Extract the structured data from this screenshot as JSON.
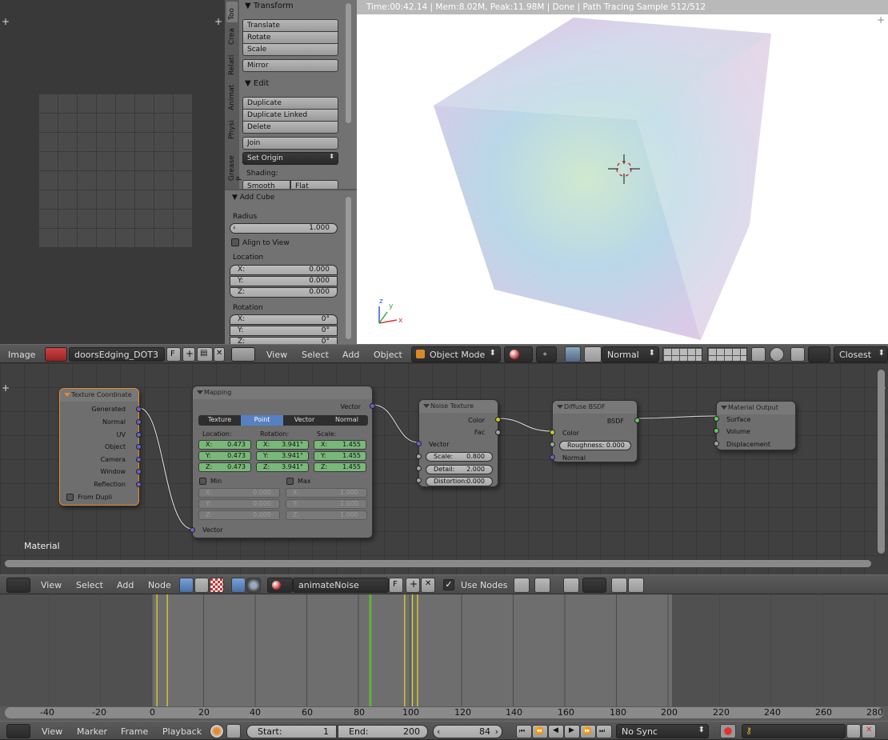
{
  "image_editor": {
    "title": "Image",
    "image_name": "doorsEdging_DOT3",
    "fake_user": "F"
  },
  "tool_tabs": [
    "Too",
    "Crea",
    "Relati",
    "Animat",
    "Physi",
    "Grease P"
  ],
  "transform": {
    "title": "Transform",
    "buttons": [
      "Translate",
      "Rotate",
      "Scale"
    ],
    "mirror": "Mirror"
  },
  "edit": {
    "title": "Edit",
    "buttons": [
      "Duplicate",
      "Duplicate Linked",
      "Delete"
    ],
    "join": "Join",
    "set_origin": "Set Origin",
    "shading_label": "Shading:",
    "shading": [
      "Smooth",
      "Flat"
    ]
  },
  "add_cube": {
    "title": "Add Cube",
    "radius_label": "Radius",
    "radius_value": "1.000",
    "align_label": "Align to View",
    "location_label": "Location",
    "location": [
      {
        "k": "X:",
        "v": "0.000"
      },
      {
        "k": "Y:",
        "v": "0.000"
      },
      {
        "k": "Z:",
        "v": "0.000"
      }
    ],
    "rotation_label": "Rotation",
    "rotation": [
      {
        "k": "X:",
        "v": "0°"
      },
      {
        "k": "Y:",
        "v": "0°"
      },
      {
        "k": "Z:",
        "v": "0°"
      }
    ]
  },
  "viewport": {
    "status": "Time:00:42.14 | Mem:8.02M, Peak:11.98M | Done | Path Tracing Sample 512/512",
    "axes": [
      "x",
      "y",
      "z"
    ],
    "menus": [
      "View",
      "Select",
      "Add",
      "Object"
    ],
    "mode": "Object Mode",
    "orientation": "Normal",
    "snap": "Closest"
  },
  "node_editor": {
    "label": "Material",
    "menus": [
      "View",
      "Select",
      "Add",
      "Node"
    ],
    "material": "animateNoise",
    "fake_user": "F",
    "use_nodes": "Use Nodes"
  },
  "nodes": {
    "texcoord": {
      "title": "Texture Coordinate",
      "outputs": [
        "Generated",
        "Normal",
        "UV",
        "Object",
        "Camera",
        "Window",
        "Reflection"
      ],
      "from_dupli": "From Dupli"
    },
    "mapping": {
      "title": "Mapping",
      "out": "Vector",
      "tabs": [
        "Texture",
        "Point",
        "Vector",
        "Normal"
      ],
      "active_tab": "Point",
      "cols": [
        "Location:",
        "Rotation:",
        "Scale:"
      ],
      "location": [
        {
          "k": "X:",
          "v": "0.473"
        },
        {
          "k": "Y:",
          "v": "0.473"
        },
        {
          "k": "Z:",
          "v": "0.473"
        }
      ],
      "rotation": [
        {
          "k": "X:",
          "v": "3.941°"
        },
        {
          "k": "Y:",
          "v": "3.941°"
        },
        {
          "k": "Z:",
          "v": "3.941°"
        }
      ],
      "scale": [
        {
          "k": "X:",
          "v": "1.455"
        },
        {
          "k": "Y:",
          "v": "1.455"
        },
        {
          "k": "Z:",
          "v": "1.455"
        }
      ],
      "min_label": "Min",
      "max_label": "Max",
      "min": [
        {
          "k": "X:",
          "v": "0.000"
        },
        {
          "k": "Y:",
          "v": "0.000"
        },
        {
          "k": "Z:",
          "v": "0.000"
        }
      ],
      "max": [
        {
          "k": "X:",
          "v": "1.000"
        },
        {
          "k": "Y:",
          "v": "1.000"
        },
        {
          "k": "Z:",
          "v": "1.000"
        }
      ],
      "in": "Vector"
    },
    "noise": {
      "title": "Noise Texture",
      "outputs": [
        "Color",
        "Fac"
      ],
      "in_vector": "Vector",
      "fields": [
        {
          "k": "Scale:",
          "v": "0.800"
        },
        {
          "k": "Detail:",
          "v": "2.000"
        },
        {
          "k": "Distortion:",
          "v": "0.000"
        }
      ]
    },
    "diffuse": {
      "title": "Diffuse BSDF",
      "out": "BSDF",
      "in_color": "Color",
      "roughness_k": "Roughness:",
      "roughness_v": "0.000",
      "in_normal": "Normal"
    },
    "output": {
      "title": "Material Output",
      "inputs": [
        "Surface",
        "Volume",
        "Displacement"
      ]
    }
  },
  "timeline": {
    "ticks": [
      "-40",
      "-20",
      "0",
      "20",
      "40",
      "60",
      "80",
      "100",
      "120",
      "140",
      "160",
      "180",
      "200",
      "220",
      "240",
      "260",
      "280"
    ],
    "menus": [
      "View",
      "Marker",
      "Frame",
      "Playback"
    ],
    "start_label": "Start:",
    "start": "1",
    "end_label": "End:",
    "end": "200",
    "current": "84",
    "sync": "No Sync",
    "current_frame": 84,
    "keyframes": [
      1,
      5,
      97,
      100,
      102
    ],
    "frame_end": 200
  },
  "colors": {
    "accent_orange": "#e88a2c",
    "active_blue": "#5680c2",
    "socket_vector": "#6363c7",
    "socket_color": "#c7c729",
    "socket_shader": "#63c763",
    "current_frame": "#5fb336"
  }
}
